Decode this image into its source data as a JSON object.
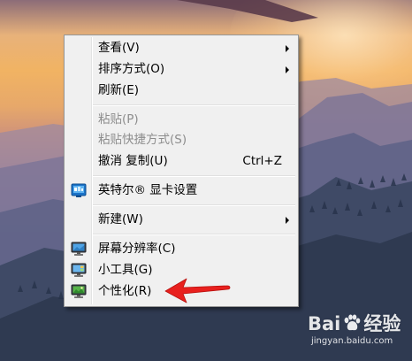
{
  "menu": {
    "items": [
      {
        "label": "查看(V)",
        "submenu": true
      },
      {
        "label": "排序方式(O)",
        "submenu": true
      },
      {
        "label": "刷新(E)"
      },
      {
        "label": "粘贴(P)",
        "disabled": true
      },
      {
        "label": "粘贴快捷方式(S)",
        "disabled": true
      },
      {
        "label": "撤消 复制(U)",
        "shortcut": "Ctrl+Z"
      },
      {
        "label": "英特尔® 显卡设置",
        "icon": "intel-graphics-icon"
      },
      {
        "label": "新建(W)",
        "submenu": true
      },
      {
        "label": "屏幕分辨率(C)",
        "icon": "monitor-resolution-icon"
      },
      {
        "label": "小工具(G)",
        "icon": "gadgets-icon"
      },
      {
        "label": "个性化(R)",
        "icon": "personalize-icon"
      }
    ]
  },
  "annotation": {
    "arrow_color": "#e8201e",
    "points_to": "个性化(R)"
  },
  "watermark": {
    "logo_left": "Bai",
    "logo_right": "经验",
    "url": "jingyan.baidu.com"
  }
}
